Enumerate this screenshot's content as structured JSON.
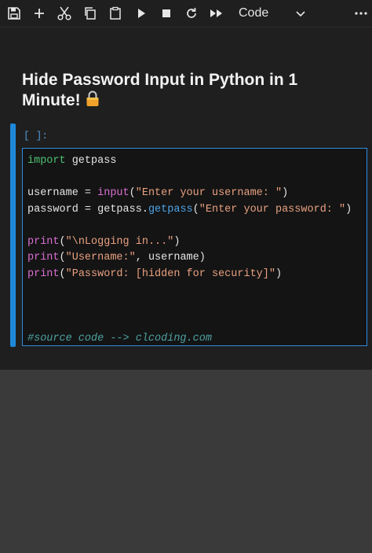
{
  "toolbar": {
    "icons": [
      "save-icon",
      "plus-icon",
      "cut-icon",
      "copy-icon",
      "paste-icon",
      "run-icon",
      "stop-icon",
      "restart-icon",
      "run-all-icon",
      "more-icon"
    ],
    "cell_type": "Code"
  },
  "markdown_cell": {
    "title": "Hide Password Input in Python in 1 Minute!",
    "emoji": "🔒"
  },
  "code_cell": {
    "execution_count": "[ ]:",
    "active_color": "#1e88d8",
    "lines": [
      [
        {
          "t": "kw",
          "v": "import"
        },
        {
          "t": "plain",
          "v": " getpass"
        }
      ],
      [],
      [
        {
          "t": "plain",
          "v": "username = "
        },
        {
          "t": "fn",
          "v": "input"
        },
        {
          "t": "plain",
          "v": "("
        },
        {
          "t": "str",
          "v": "\"Enter your username: \""
        },
        {
          "t": "plain",
          "v": ")"
        }
      ],
      [
        {
          "t": "plain",
          "v": "password = getpass."
        },
        {
          "t": "meth",
          "v": "getpass"
        },
        {
          "t": "plain",
          "v": "("
        },
        {
          "t": "str",
          "v": "\"Enter your password: \""
        },
        {
          "t": "plain",
          "v": ")"
        }
      ],
      [],
      [
        {
          "t": "fn",
          "v": "print"
        },
        {
          "t": "plain",
          "v": "("
        },
        {
          "t": "str",
          "v": "\"\\nLogging in...\""
        },
        {
          "t": "plain",
          "v": ")"
        }
      ],
      [
        {
          "t": "fn",
          "v": "print"
        },
        {
          "t": "plain",
          "v": "("
        },
        {
          "t": "str",
          "v": "\"Username:\""
        },
        {
          "t": "plain",
          "v": ", username)"
        }
      ],
      [
        {
          "t": "fn",
          "v": "print"
        },
        {
          "t": "plain",
          "v": "("
        },
        {
          "t": "str",
          "v": "\"Password: [hidden for security]\""
        },
        {
          "t": "plain",
          "v": ")"
        }
      ],
      [],
      [],
      [],
      [
        {
          "t": "cmt",
          "v": "#source code --> clcoding.com"
        }
      ]
    ]
  },
  "colors": {
    "notebook_bg": "#1f1f1f",
    "page_bg": "#3a3a3a",
    "editor_border": "#2f8be0",
    "keyword": "#4ec072",
    "builtin": "#d86fd0",
    "method": "#4ca4e8",
    "string": "#e8a080",
    "comment": "#4ea2a2"
  }
}
